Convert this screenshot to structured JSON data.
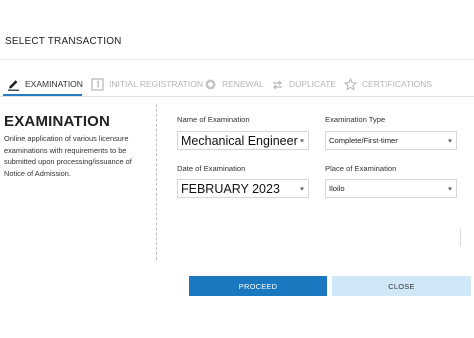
{
  "modal": {
    "title": "SELECT TRANSACTION"
  },
  "tabs": [
    {
      "label": "EXAMINATION",
      "icon": "pencil-icon",
      "active": true
    },
    {
      "label": "INITIAL REGISTRATION",
      "icon": "number-one-box-icon",
      "active": false
    },
    {
      "label": "RENEWAL",
      "icon": "badge-icon",
      "active": false
    },
    {
      "label": "DUPLICATE",
      "icon": "swap-arrows-icon",
      "active": false
    },
    {
      "label": "CERTIFICATIONS",
      "icon": "star-icon",
      "active": false
    }
  ],
  "info": {
    "heading": "EXAMINATION",
    "description": "Online application of various licensure examinations with requirements to be submitted upon processing/issuance of Notice of Admission."
  },
  "form": {
    "name_of_examination": {
      "label": "Name of Examination",
      "value": "Mechanical Engineer"
    },
    "examination_type": {
      "label": "Examination Type",
      "value": "Complete/First-timer"
    },
    "date_of_examination": {
      "label": "Date of Examination",
      "value": "FEBRUARY 2023"
    },
    "place_of_examination": {
      "label": "Place of Examination",
      "value": "Iloilo"
    }
  },
  "actions": {
    "proceed_label": "PROCEED",
    "close_label": "CLOSE"
  },
  "colors": {
    "accent": "#1a78c1",
    "close_button_bg": "#cfe7f6",
    "inactive_tab": "#b5b5b5"
  }
}
